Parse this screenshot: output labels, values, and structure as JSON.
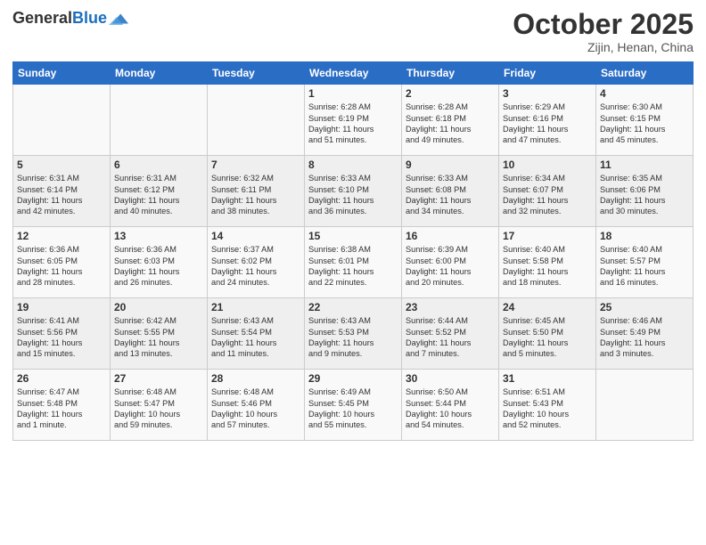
{
  "header": {
    "logo_line1": "General",
    "logo_line2": "Blue",
    "title": "October 2025",
    "location": "Zijin, Henan, China"
  },
  "days_of_week": [
    "Sunday",
    "Monday",
    "Tuesday",
    "Wednesday",
    "Thursday",
    "Friday",
    "Saturday"
  ],
  "weeks": [
    [
      {
        "day": "",
        "info": ""
      },
      {
        "day": "",
        "info": ""
      },
      {
        "day": "",
        "info": ""
      },
      {
        "day": "1",
        "info": "Sunrise: 6:28 AM\nSunset: 6:19 PM\nDaylight: 11 hours\nand 51 minutes."
      },
      {
        "day": "2",
        "info": "Sunrise: 6:28 AM\nSunset: 6:18 PM\nDaylight: 11 hours\nand 49 minutes."
      },
      {
        "day": "3",
        "info": "Sunrise: 6:29 AM\nSunset: 6:16 PM\nDaylight: 11 hours\nand 47 minutes."
      },
      {
        "day": "4",
        "info": "Sunrise: 6:30 AM\nSunset: 6:15 PM\nDaylight: 11 hours\nand 45 minutes."
      }
    ],
    [
      {
        "day": "5",
        "info": "Sunrise: 6:31 AM\nSunset: 6:14 PM\nDaylight: 11 hours\nand 42 minutes."
      },
      {
        "day": "6",
        "info": "Sunrise: 6:31 AM\nSunset: 6:12 PM\nDaylight: 11 hours\nand 40 minutes."
      },
      {
        "day": "7",
        "info": "Sunrise: 6:32 AM\nSunset: 6:11 PM\nDaylight: 11 hours\nand 38 minutes."
      },
      {
        "day": "8",
        "info": "Sunrise: 6:33 AM\nSunset: 6:10 PM\nDaylight: 11 hours\nand 36 minutes."
      },
      {
        "day": "9",
        "info": "Sunrise: 6:33 AM\nSunset: 6:08 PM\nDaylight: 11 hours\nand 34 minutes."
      },
      {
        "day": "10",
        "info": "Sunrise: 6:34 AM\nSunset: 6:07 PM\nDaylight: 11 hours\nand 32 minutes."
      },
      {
        "day": "11",
        "info": "Sunrise: 6:35 AM\nSunset: 6:06 PM\nDaylight: 11 hours\nand 30 minutes."
      }
    ],
    [
      {
        "day": "12",
        "info": "Sunrise: 6:36 AM\nSunset: 6:05 PM\nDaylight: 11 hours\nand 28 minutes."
      },
      {
        "day": "13",
        "info": "Sunrise: 6:36 AM\nSunset: 6:03 PM\nDaylight: 11 hours\nand 26 minutes."
      },
      {
        "day": "14",
        "info": "Sunrise: 6:37 AM\nSunset: 6:02 PM\nDaylight: 11 hours\nand 24 minutes."
      },
      {
        "day": "15",
        "info": "Sunrise: 6:38 AM\nSunset: 6:01 PM\nDaylight: 11 hours\nand 22 minutes."
      },
      {
        "day": "16",
        "info": "Sunrise: 6:39 AM\nSunset: 6:00 PM\nDaylight: 11 hours\nand 20 minutes."
      },
      {
        "day": "17",
        "info": "Sunrise: 6:40 AM\nSunset: 5:58 PM\nDaylight: 11 hours\nand 18 minutes."
      },
      {
        "day": "18",
        "info": "Sunrise: 6:40 AM\nSunset: 5:57 PM\nDaylight: 11 hours\nand 16 minutes."
      }
    ],
    [
      {
        "day": "19",
        "info": "Sunrise: 6:41 AM\nSunset: 5:56 PM\nDaylight: 11 hours\nand 15 minutes."
      },
      {
        "day": "20",
        "info": "Sunrise: 6:42 AM\nSunset: 5:55 PM\nDaylight: 11 hours\nand 13 minutes."
      },
      {
        "day": "21",
        "info": "Sunrise: 6:43 AM\nSunset: 5:54 PM\nDaylight: 11 hours\nand 11 minutes."
      },
      {
        "day": "22",
        "info": "Sunrise: 6:43 AM\nSunset: 5:53 PM\nDaylight: 11 hours\nand 9 minutes."
      },
      {
        "day": "23",
        "info": "Sunrise: 6:44 AM\nSunset: 5:52 PM\nDaylight: 11 hours\nand 7 minutes."
      },
      {
        "day": "24",
        "info": "Sunrise: 6:45 AM\nSunset: 5:50 PM\nDaylight: 11 hours\nand 5 minutes."
      },
      {
        "day": "25",
        "info": "Sunrise: 6:46 AM\nSunset: 5:49 PM\nDaylight: 11 hours\nand 3 minutes."
      }
    ],
    [
      {
        "day": "26",
        "info": "Sunrise: 6:47 AM\nSunset: 5:48 PM\nDaylight: 11 hours\nand 1 minute."
      },
      {
        "day": "27",
        "info": "Sunrise: 6:48 AM\nSunset: 5:47 PM\nDaylight: 10 hours\nand 59 minutes."
      },
      {
        "day": "28",
        "info": "Sunrise: 6:48 AM\nSunset: 5:46 PM\nDaylight: 10 hours\nand 57 minutes."
      },
      {
        "day": "29",
        "info": "Sunrise: 6:49 AM\nSunset: 5:45 PM\nDaylight: 10 hours\nand 55 minutes."
      },
      {
        "day": "30",
        "info": "Sunrise: 6:50 AM\nSunset: 5:44 PM\nDaylight: 10 hours\nand 54 minutes."
      },
      {
        "day": "31",
        "info": "Sunrise: 6:51 AM\nSunset: 5:43 PM\nDaylight: 10 hours\nand 52 minutes."
      },
      {
        "day": "",
        "info": ""
      }
    ]
  ]
}
